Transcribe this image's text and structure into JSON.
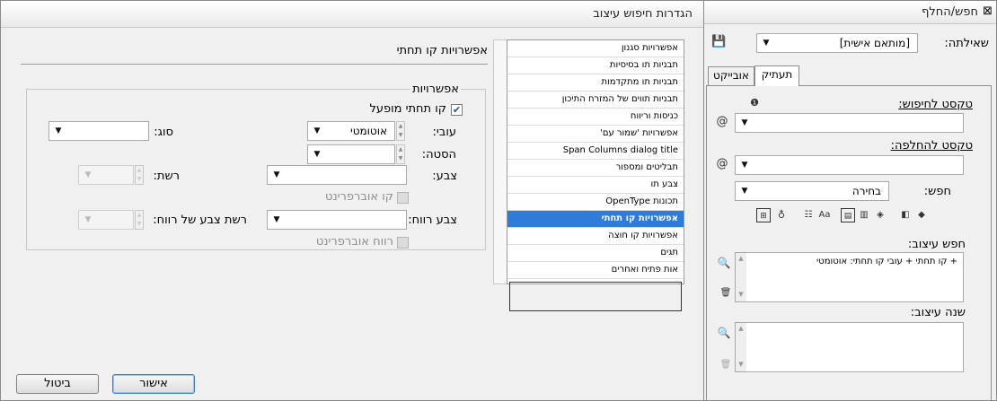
{
  "dialog": {
    "title": "הגדרות חיפוש עיצוב",
    "section_title": "אפשרויות קו תחתי",
    "categories": [
      "אפשרויות סגנון",
      "תבניות תו בסיסיות",
      "תבניות תו מתקדמות",
      "תבניות תווים של המזרח התיכון",
      "כניסות וריווח",
      "אפשרויות 'שמור עם'",
      "Span Columns dialog title",
      "תבליטים ומספור",
      "צבע תו",
      "תכונות OpenType",
      "אפשרויות קו תחתי",
      "אפשרויות קו חוצה",
      "תגים",
      "אות פתיח ואחרים"
    ],
    "selected_index": 10,
    "options_group_label": "אפשרויות",
    "underline_on_label": "קו תחתי מופעל",
    "underline_on_checked": true,
    "weight_label": "עובי:",
    "weight_value": "אוטומטי",
    "type_label": "סוג:",
    "type_value": "",
    "offset_label": "הסטה:",
    "offset_value": "",
    "color_label": "צבע:",
    "color_value": "",
    "tint_label": "רשת:",
    "overprint_stroke_label": "קו אוברפרינט",
    "gap_color_label": "צבע רווח:",
    "gap_color_value": "",
    "gap_tint_label": "רשת צבע של רווח:",
    "overprint_gap_label": "רווח אוברפרינט",
    "ok_label": "אישור",
    "cancel_label": "ביטול"
  },
  "panel": {
    "title": "חפש/החלף",
    "close_glyph": "⊠",
    "query_label": "שאילתה:",
    "query_value": "[מותאם אישית]",
    "tabs": [
      "תעתיק",
      "אובייקט"
    ],
    "find_label": "טקסט לחיפוש:",
    "find_value": "",
    "change_label": "טקסט להחלפה:",
    "change_value": "",
    "search_label": "חפש:",
    "search_value": "בחירה",
    "find_format_label": "חפש עיצוב:",
    "find_format_value": "+ קו תחתי + עובי קו תחתי: אוטומטי",
    "change_format_label": "שנה עיצוב:",
    "change_format_value": "",
    "info_glyph": "❶",
    "at_glyph": "@",
    "save_glyph": "💾",
    "case_glyph": "Aa",
    "bomb_glyph": "⌛"
  }
}
